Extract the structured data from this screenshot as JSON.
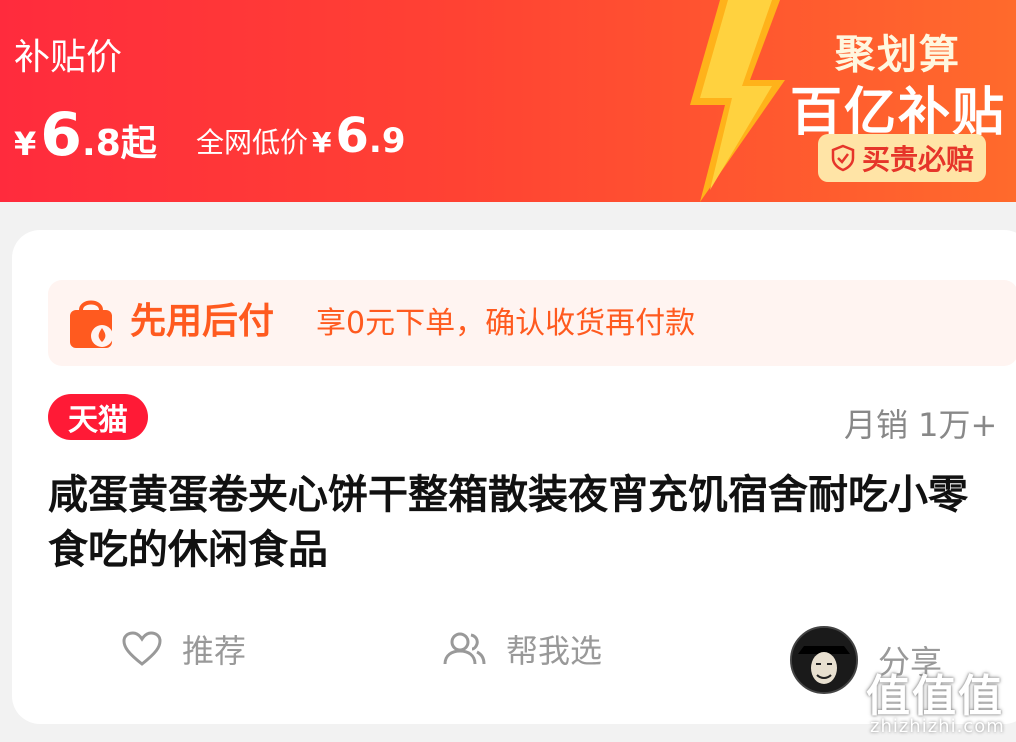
{
  "banner": {
    "subsidy_label": "补贴价",
    "price": {
      "currency": "¥",
      "int": "6",
      "dec": ".8",
      "suffix": "起"
    },
    "lowest": {
      "label": "全网低价",
      "currency": "¥",
      "int": "6",
      "dec": ".9"
    },
    "brand": "聚划算",
    "slogan": "百亿补贴",
    "guarantee": "买贵必赔"
  },
  "pay_later": {
    "title": "先用后付",
    "desc": "享0元下单，确认收货再付款"
  },
  "product": {
    "store_tag": "天猫",
    "monthly_sales": "月销 1万+",
    "title": "咸蛋黄蛋卷夹心饼干整箱散装夜宵充饥宿舍耐吃小零食吃的休闲食品"
  },
  "actions": {
    "recommend": "推荐",
    "help_choose": "帮我选",
    "share": "分享"
  },
  "watermark": {
    "text": "值值值",
    "url": "zhizhizhi.com"
  },
  "colors": {
    "banner_start": "#ff2b3d",
    "banner_end": "#ff6a2c",
    "pay_orange": "#ff5a1f",
    "tmall_red": "#ff1a36"
  }
}
